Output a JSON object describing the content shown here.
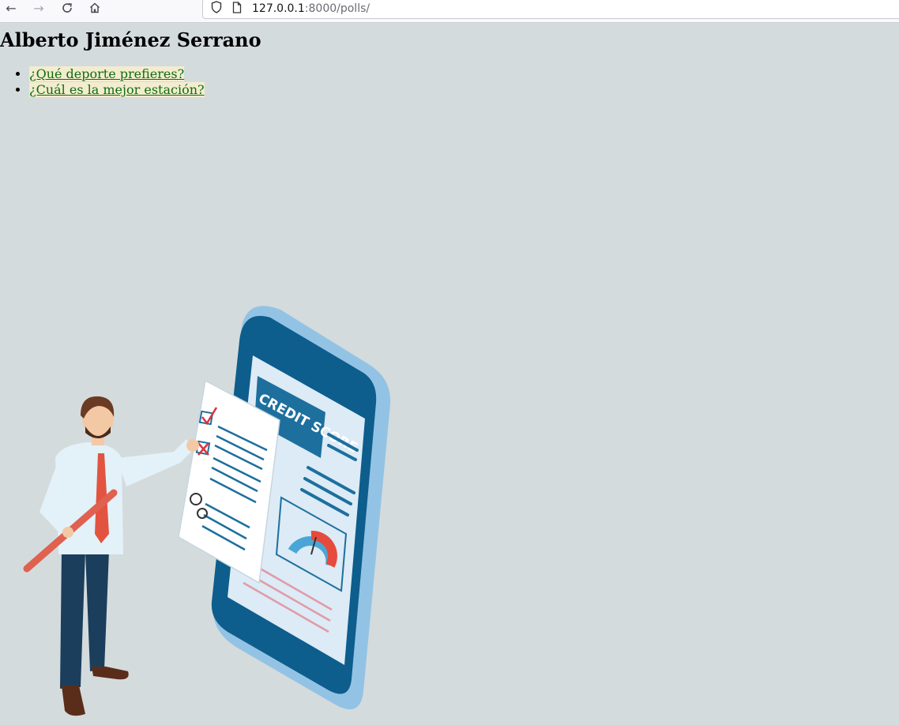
{
  "browser": {
    "url_host": "127.0.0.1",
    "url_path": ":8000/polls/"
  },
  "page": {
    "title": "Alberto Jiménez Serrano",
    "polls": [
      {
        "label": "¿Qué deporte prefieres?"
      },
      {
        "label": "¿Cuál es la mejor estación?"
      }
    ]
  },
  "illustration": {
    "phone_heading": "CREDIT SCORE"
  },
  "colors": {
    "page_background": "#d4dbdd",
    "link_text": "#0d6e0d",
    "link_highlight": "#f3eccf",
    "phone_body": "#93c3e4",
    "phone_dark": "#0d5d8d"
  }
}
